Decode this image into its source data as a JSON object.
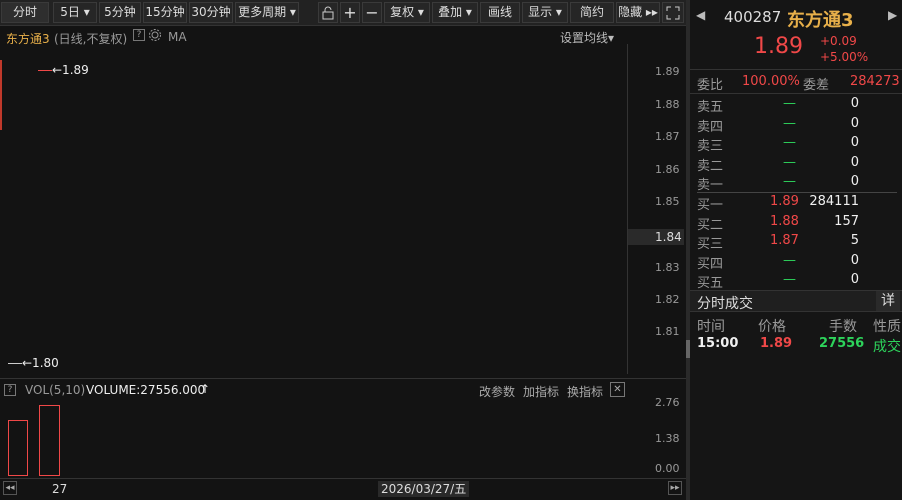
{
  "toolbar": {
    "period_buttons": [
      "分时",
      "5日 ▾",
      "5分钟",
      "15分钟",
      "30分钟",
      "更多周期 ▾"
    ],
    "tool_buttons": [
      "复权 ▾",
      "叠加 ▾",
      "画线",
      "显示 ▾",
      "简约",
      "隐藏 ▸▸"
    ]
  },
  "chart": {
    "title": "东方通3",
    "subtitle": "(日线,不复权)",
    "indicator": "MA",
    "settings_label": "设置均线▾",
    "high_marker": "←1.89",
    "low_marker": "←1.80",
    "y_ticks": [
      "1.89",
      "1.88",
      "1.87",
      "1.86",
      "1.85",
      "1.84",
      "1.83",
      "1.82",
      "1.81"
    ],
    "current_price_tick": "1.84"
  },
  "volume": {
    "help": "?",
    "name": "VOL(5,10)",
    "value": "VOLUME:27556.000",
    "arrow": "↑",
    "actions": [
      "改参数",
      "加指标",
      "换指标"
    ],
    "close": "✕",
    "y_ticks": [
      "2.76",
      "1.38",
      "0.00"
    ],
    "x_label": "27",
    "date_label": "2026/03/27/五",
    "bars_relative": [
      0.64,
      0.82
    ]
  },
  "quote": {
    "code": "400287",
    "name": "东方通3",
    "price": "1.89",
    "change": "+0.09",
    "change_pct": "+5.00%",
    "weibi_label": "委比",
    "weibi_value": "100.00%",
    "weicha_label": "委差",
    "weicha_value": "284273",
    "asks": [
      {
        "label": "卖五",
        "price": "—",
        "vol": "0"
      },
      {
        "label": "卖四",
        "price": "—",
        "vol": "0"
      },
      {
        "label": "卖三",
        "price": "—",
        "vol": "0"
      },
      {
        "label": "卖二",
        "price": "—",
        "vol": "0"
      },
      {
        "label": "卖一",
        "price": "—",
        "vol": "0"
      }
    ],
    "bids": [
      {
        "label": "买一",
        "price": "1.89",
        "vol": "284111"
      },
      {
        "label": "买二",
        "price": "1.88",
        "vol": "157"
      },
      {
        "label": "买三",
        "price": "1.87",
        "vol": "5"
      },
      {
        "label": "买四",
        "price": "—",
        "vol": "0"
      },
      {
        "label": "买五",
        "price": "—",
        "vol": "0"
      }
    ],
    "trades_title": "分时成交",
    "detail_btn": "详",
    "trade_headers": [
      "时间",
      "价格",
      "手数",
      "性质"
    ],
    "trades": [
      {
        "time": "15:00",
        "price": "1.89",
        "vol": "27556",
        "type": "成交"
      }
    ]
  },
  "colors": {
    "up": "#f04848",
    "down": "#2dd35b",
    "accent": "#e8b04a"
  }
}
